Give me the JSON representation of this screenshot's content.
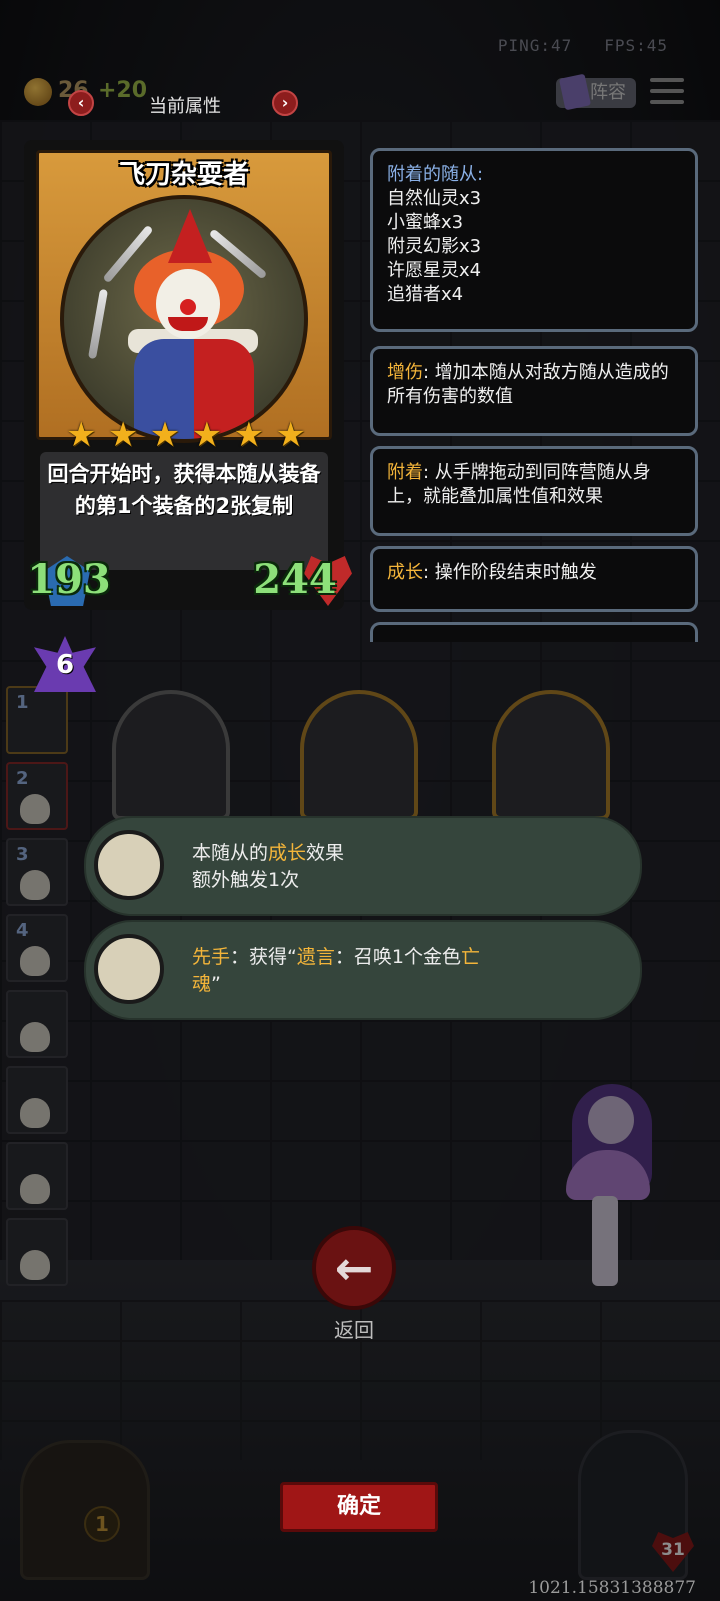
{
  "hud": {
    "ping_text": "PING:47",
    "fps_text": "FPS:45",
    "gold": "26",
    "gold_bonus": "+20",
    "lineup_label": "阵容"
  },
  "header": {
    "title": "当前属性",
    "prev_arrow": "‹",
    "next_arrow": "›"
  },
  "card": {
    "name": "飞刀杂耍者",
    "stars": [
      "★",
      "★",
      "★",
      "★",
      "★",
      "★"
    ],
    "star_count": 6,
    "description": "回合开始时，获得本随从装备的第1个装备的2张复制",
    "attack": "193",
    "health": "244",
    "level": "6"
  },
  "attached": {
    "title": "附着的随从:",
    "items": [
      "自然仙灵x3",
      "小蜜蜂x3",
      "附灵幻影x3",
      "许愿星灵x4",
      "追猎者x4"
    ]
  },
  "keywords": [
    {
      "term": "增伤",
      "sep": ": ",
      "desc": "增加本随从对敌方随从造成的所有伤害的数值"
    },
    {
      "term": "附着",
      "sep": ": ",
      "desc": "从手牌拖动到同阵营随从身上，就能叠加属性值和效果"
    },
    {
      "term": "成长",
      "sep": ": ",
      "desc": "操作阶段结束时触发"
    }
  ],
  "slots": [
    "1",
    "2",
    "3",
    "4",
    "",
    "",
    "",
    ""
  ],
  "effects": [
    {
      "line1_a": "本随从的",
      "line1_kw": "成长",
      "line1_b": "效果",
      "line2": "额外触发1次"
    },
    {
      "kw_a": "先手",
      "text_a": "：获得“",
      "kw_b": "遗言",
      "text_b": "：召唤1个金色",
      "kw_c": "亡",
      "line2_kw": "魂",
      "line2_text": "”"
    }
  ],
  "back_label": "返回",
  "back_arrow": "←",
  "confirm_label": "确定",
  "bottom": {
    "coin": "1",
    "heart_value": "31"
  },
  "footer_id": "1021.15831388877",
  "colors": {
    "keyword": "#f4b53a",
    "stat_number": "#8de07a",
    "confirm": "#a01616"
  }
}
